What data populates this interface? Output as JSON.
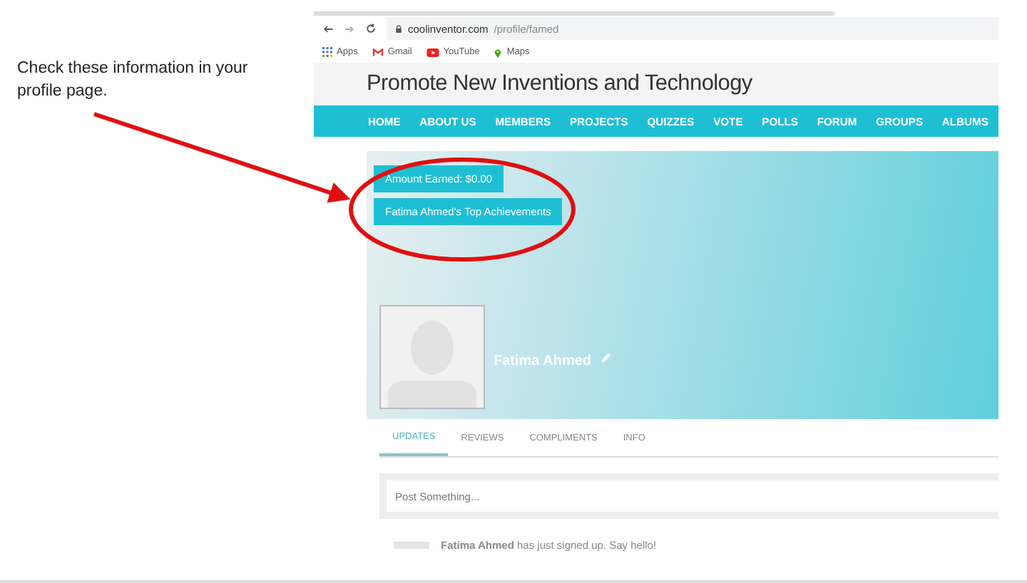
{
  "annotation": {
    "text": "Check these information in your profile page."
  },
  "browser": {
    "url_host": "coolinventor.com",
    "url_path": "/profile/famed",
    "bookmarks": [
      {
        "label": "Apps",
        "kind": "apps"
      },
      {
        "label": "Gmail",
        "kind": "mail"
      },
      {
        "label": "YouTube",
        "kind": "video"
      },
      {
        "label": "Maps",
        "kind": "pin"
      }
    ]
  },
  "site": {
    "title": "Promote New Inventions and Technology",
    "nav": [
      "HOME",
      "ABOUT US",
      "MEMBERS",
      "PROJECTS",
      "QUIZZES",
      "VOTE",
      "POLLS",
      "FORUM",
      "GROUPS",
      "ALBUMS"
    ]
  },
  "profile": {
    "buttons": [
      "Amount Earned: $0.00",
      "Fatima Ahmed's Top Achievements"
    ],
    "name": "Fatima Ahmed",
    "tabs": [
      {
        "label": "UPDATES",
        "selected": true
      },
      {
        "label": "REVIEWS",
        "selected": false
      },
      {
        "label": "COMPLIMENTS",
        "selected": false
      },
      {
        "label": "INFO",
        "selected": false
      }
    ],
    "post": {
      "placeholder": "Post Something..."
    },
    "activity": "**Fatima Ahmed** has just signed up. Say hello!"
  }
}
